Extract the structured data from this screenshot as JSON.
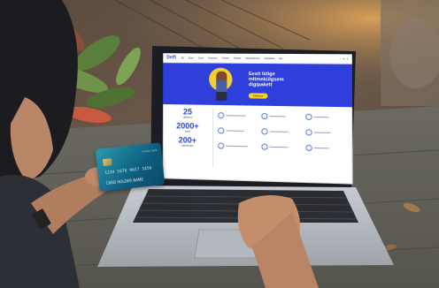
{
  "website": {
    "logo": "Delfi",
    "nav": [
      "Ek",
      "Eesti",
      "Sport",
      "Arvamus",
      "Kultuur",
      "Teadus",
      "Meelelahutus",
      "Naistekas",
      "Elu"
    ],
    "hero_title": [
      "Eesti lidige",
      "mitmekülgsem",
      "digipakett"
    ],
    "hero_button": "Tellimine",
    "stats": [
      {
        "number": "25",
        "label": "väljaannet"
      },
      {
        "number": "2000+",
        "label": "artiklit"
      },
      {
        "number": "200+",
        "label": "ajakirjanikku"
      }
    ]
  },
  "card": {
    "number": "1234 5678 9017 3456",
    "holder": "CARD HOLDER NAME",
    "brand": "Credit Card"
  },
  "colors": {
    "brand_blue": "#2e3fdc",
    "accent_yellow": "#f4d227",
    "card_teal": "#1a7f97"
  }
}
